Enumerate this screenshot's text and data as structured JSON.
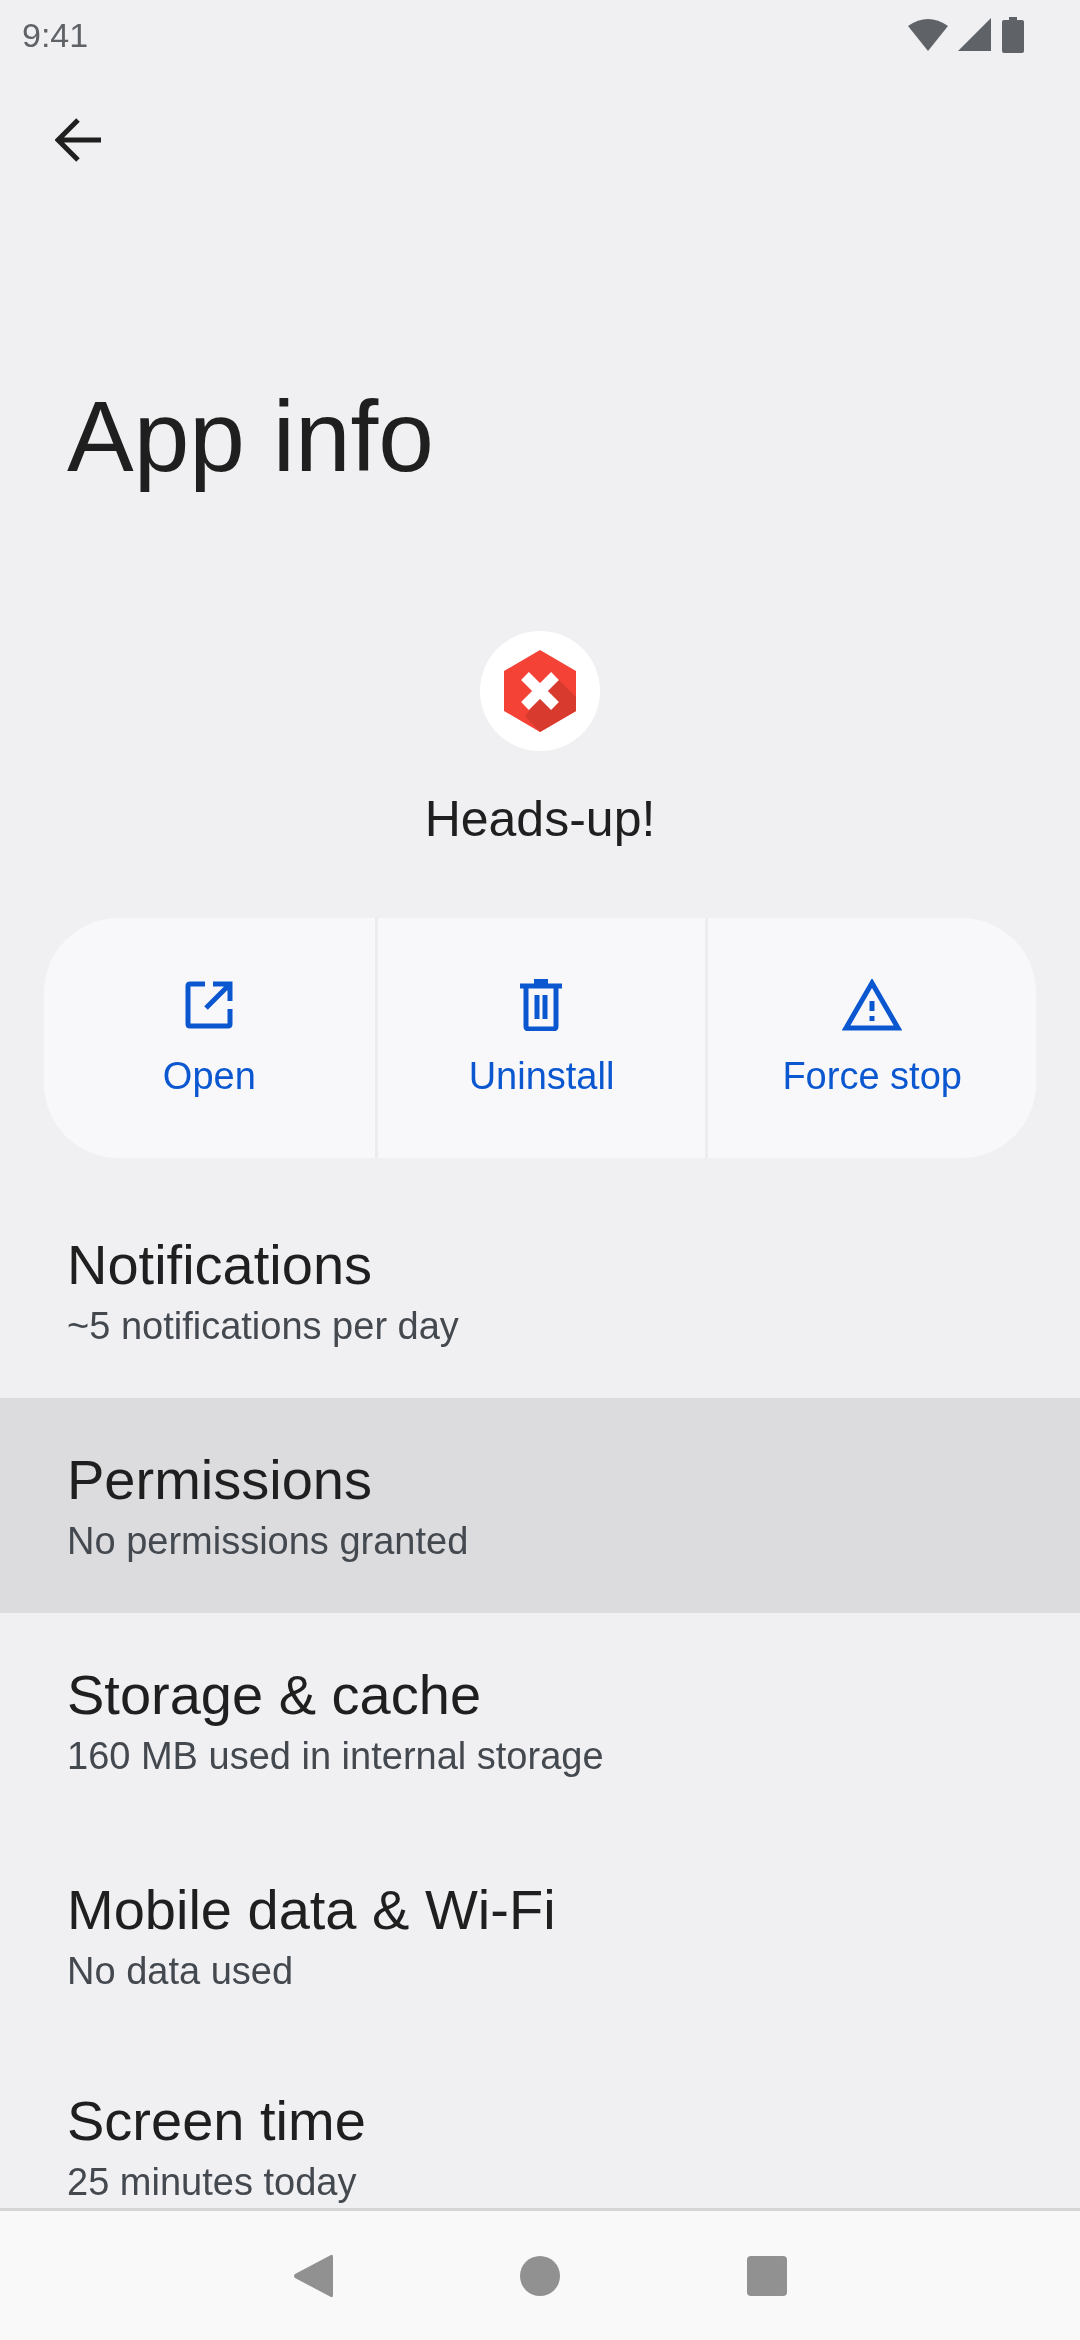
{
  "status_bar": {
    "time": "9:41"
  },
  "title": "App info",
  "app": {
    "name": "Heads-up!"
  },
  "actions": [
    {
      "kind": "open",
      "label": "Open"
    },
    {
      "kind": "uninstall",
      "label": "Uninstall"
    },
    {
      "kind": "force_stop",
      "label": "Force stop"
    }
  ],
  "settings": [
    {
      "title": "Notifications",
      "summary": "~5 notifications per day",
      "selected": false
    },
    {
      "title": "Permissions",
      "summary": "No permissions granted",
      "selected": true
    },
    {
      "title": "Storage & cache",
      "summary": "160 MB used in internal storage",
      "selected": false
    },
    {
      "title": "Mobile data & Wi-Fi",
      "summary": "No data used",
      "selected": false
    },
    {
      "title": "Screen time",
      "summary": "25 minutes today",
      "selected": false
    }
  ]
}
